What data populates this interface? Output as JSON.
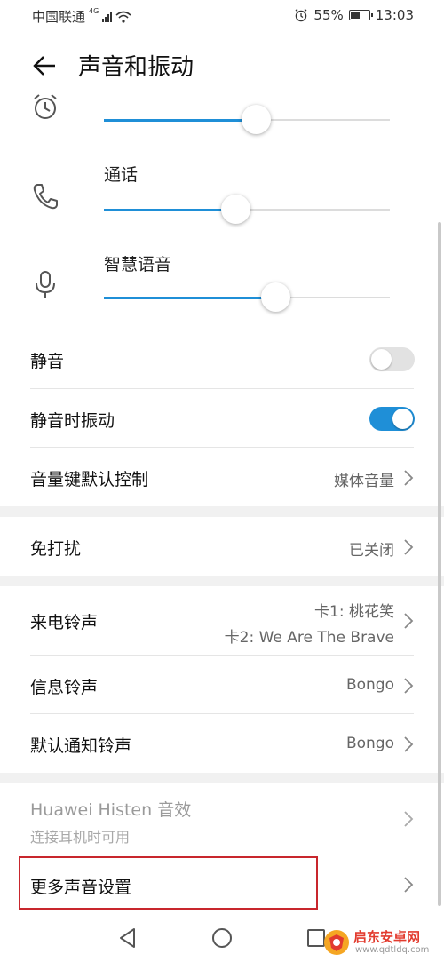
{
  "status_bar": {
    "carrier": "中国联通",
    "network": "4G",
    "battery": "55%",
    "battery_level": 0.55,
    "time": "13:03"
  },
  "header": {
    "title": "声音和振动"
  },
  "volumes": [
    {
      "label": "",
      "icon": "alarm-clock-icon",
      "level": 0.53
    },
    {
      "label": "通话",
      "icon": "phone-icon",
      "level": 0.46
    },
    {
      "label": "智慧语音",
      "icon": "microphone-icon",
      "level": 0.6
    }
  ],
  "settings": {
    "mute": {
      "label": "静音",
      "on": false
    },
    "vibrate_on_mute": {
      "label": "静音时振动",
      "on": true
    },
    "volume_key": {
      "label": "音量键默认控制",
      "value": "媒体音量"
    },
    "dnd": {
      "label": "免打扰",
      "value": "已关闭"
    },
    "ringtone": {
      "label": "来电铃声",
      "value_line1": "卡1: 桃花笑",
      "value_line2": "卡2: We Are The Brave"
    },
    "message_tone": {
      "label": "信息铃声",
      "value": "Bongo"
    },
    "notification_tone": {
      "label": "默认通知铃声",
      "value": "Bongo"
    },
    "histen": {
      "label": "Huawei Histen 音效",
      "sublabel": "连接耳机时可用"
    },
    "more": {
      "label": "更多声音设置"
    }
  },
  "nav": {
    "back": "back-triangle-icon",
    "home": "home-circle-icon",
    "recent": "recent-square-icon"
  },
  "watermark": {
    "text": "启东安卓网",
    "sub": "www.qdtldq.com"
  },
  "colors": {
    "accent": "#1f8fd7",
    "highlight": "#c8262d"
  }
}
